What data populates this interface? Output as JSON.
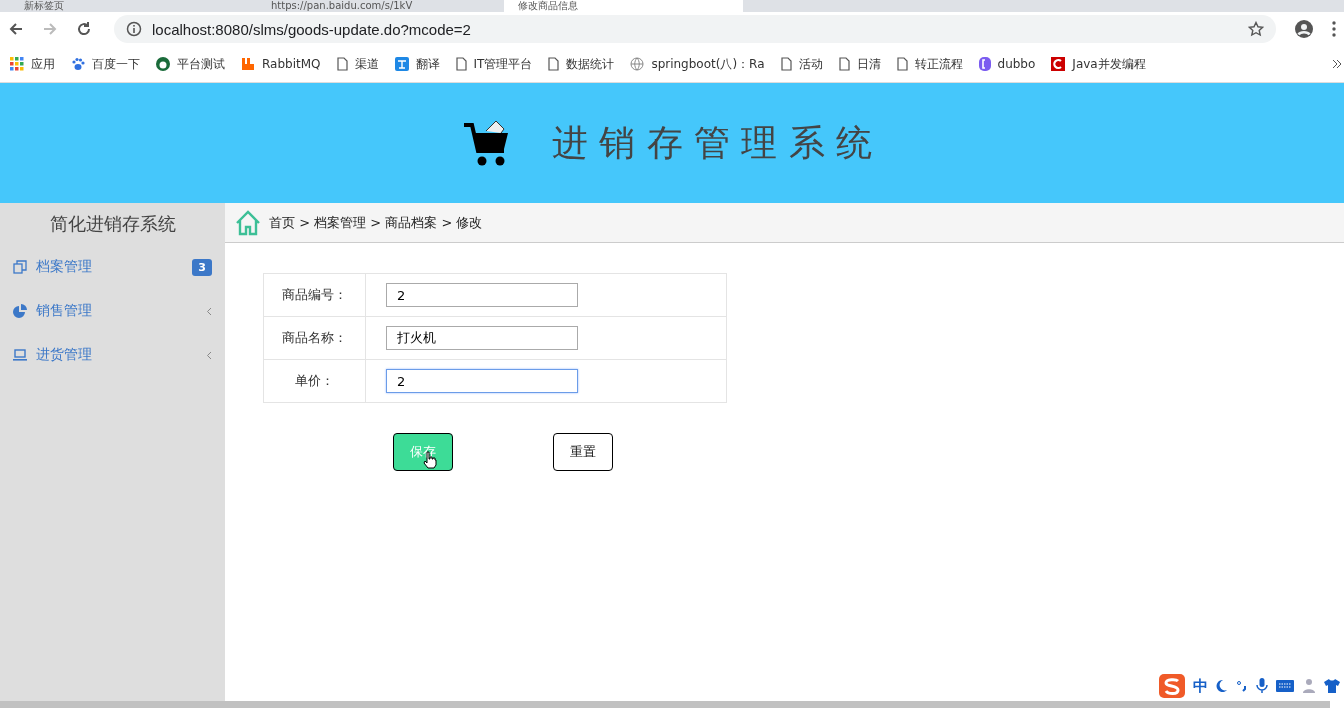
{
  "browser": {
    "tabs": [
      {
        "title": "新标签页",
        "selected": false
      },
      {
        "title": "https://pan.baidu.com/s/1kV",
        "selected": false
      },
      {
        "title": "修改商品信息",
        "selected": true
      }
    ],
    "url": "localhost:8080/slms/goods-update.do?mcode=2",
    "bookmarks": [
      {
        "label": "应用",
        "kind": "apps"
      },
      {
        "label": "百度一下",
        "kind": "paw"
      },
      {
        "label": "平台测试",
        "kind": "panda"
      },
      {
        "label": "RabbitMQ",
        "kind": "rabbit"
      },
      {
        "label": "渠道",
        "kind": "page"
      },
      {
        "label": "翻译",
        "kind": "translate"
      },
      {
        "label": "IT管理平台",
        "kind": "page"
      },
      {
        "label": "数据统计",
        "kind": "page"
      },
      {
        "label": "springboot(八)：Ra",
        "kind": "globe"
      },
      {
        "label": "活动",
        "kind": "page"
      },
      {
        "label": "日清",
        "kind": "page"
      },
      {
        "label": "转正流程",
        "kind": "page"
      },
      {
        "label": "dubbo",
        "kind": "dubbo"
      },
      {
        "label": "Java并发编程",
        "kind": "java"
      }
    ]
  },
  "header": {
    "title": "进 销 存 管 理 系 统"
  },
  "sidebar": {
    "title": "简化进销存系统",
    "items": [
      {
        "label": "档案管理",
        "badge": "3"
      },
      {
        "label": "销售管理"
      },
      {
        "label": "进货管理"
      }
    ]
  },
  "breadcrumb": "首页 > 档案管理 > 商品档案 > 修改",
  "form": {
    "fields": [
      {
        "label": "商品编号：",
        "value": "2",
        "focused": false
      },
      {
        "label": "商品名称：",
        "value": "打火机",
        "focused": false
      },
      {
        "label": "单价：",
        "value": "2",
        "focused": true
      }
    ],
    "buttons": [
      {
        "label": "保存",
        "kind": "primary"
      },
      {
        "label": "重置",
        "kind": "default"
      }
    ]
  },
  "tray": {
    "ime": "中"
  }
}
